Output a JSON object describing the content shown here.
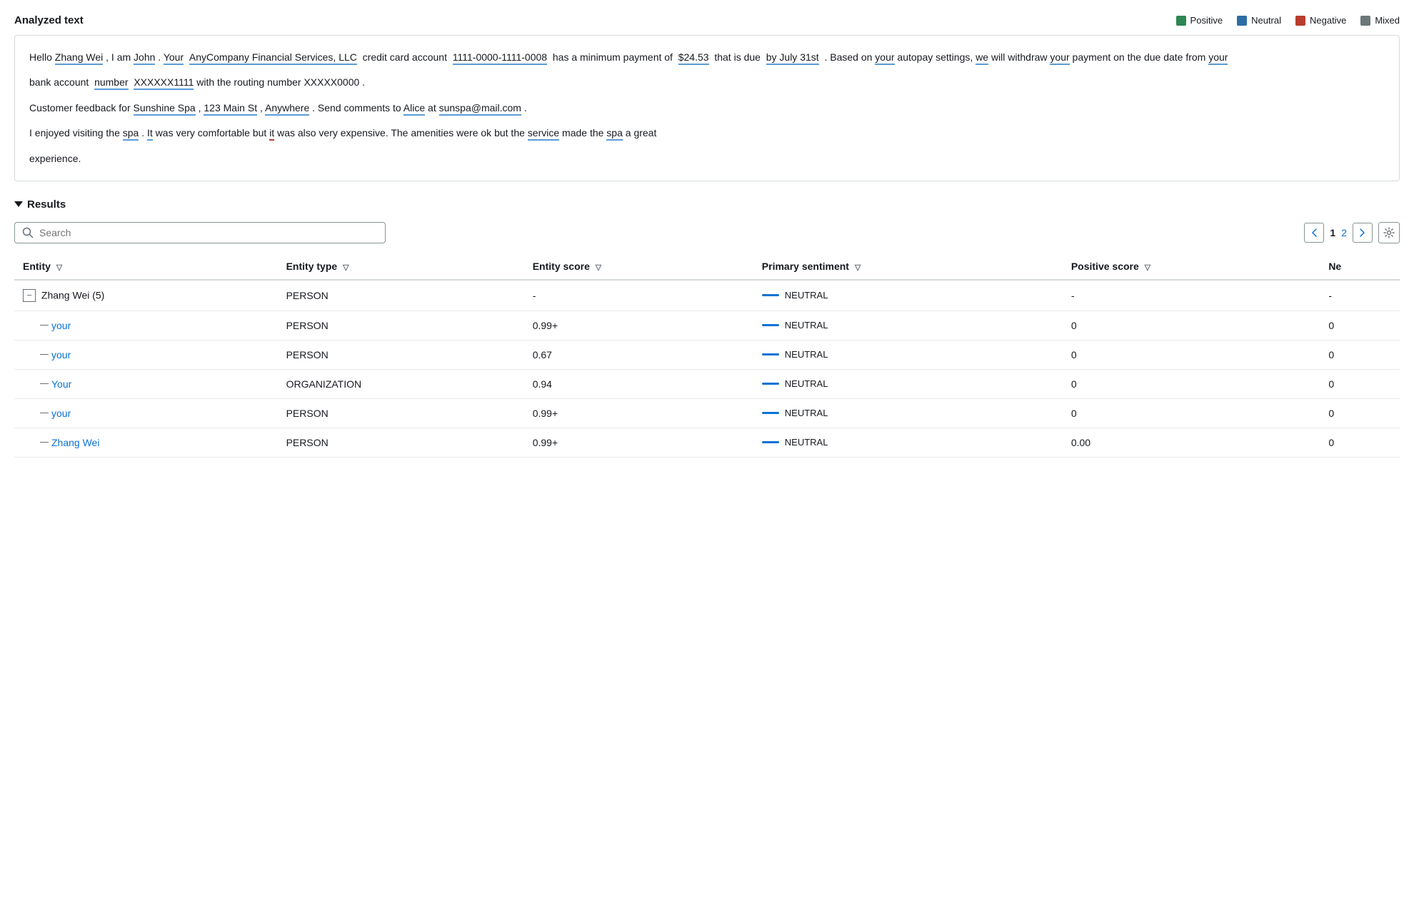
{
  "header": {
    "title": "Analyzed text"
  },
  "legend": [
    {
      "label": "Positive",
      "color": "#2d8653"
    },
    {
      "label": "Neutral",
      "color": "#2e6da4"
    },
    {
      "label": "Negative",
      "color": "#b83c2b"
    },
    {
      "label": "Mixed",
      "color": "#6c7778"
    }
  ],
  "analyzed_text": {
    "lines": [
      "Hello Zhang Wei , I am John . Your AnyCompany Financial Services, LLC credit card account 1111-0000-1111-0008 has a minimum payment of $24.53 that is due by July 31st . Based on your autopay settings, we will withdraw your payment on the due date from your bank account number XXXXXX1111 with the routing number XXXXX0000 .",
      "Customer feedback for Sunshine Spa , 123 Main St , Anywhere . Send comments to Alice at sunspa@mail.com .",
      "I enjoyed visiting the spa . It was very comfortable but it was also very expensive. The amenities were ok but the service made the spa a great experience."
    ]
  },
  "results": {
    "title": "Results",
    "search": {
      "placeholder": "Search"
    },
    "pagination": {
      "current": "1",
      "next": "2",
      "prev_label": "<",
      "next_label": ">"
    },
    "columns": [
      {
        "label": "Entity",
        "key": "entity"
      },
      {
        "label": "Entity type",
        "key": "type"
      },
      {
        "label": "Entity score",
        "key": "score"
      },
      {
        "label": "Primary sentiment",
        "key": "sentiment"
      },
      {
        "label": "Positive score",
        "key": "positive_score"
      },
      {
        "label": "Ne",
        "key": "ne_score"
      }
    ],
    "rows": [
      {
        "id": "zhang-wei-group",
        "entity": "Zhang Wei (5)",
        "type": "PERSON",
        "score": "-",
        "sentiment": "NEUTRAL",
        "positive_score": "-",
        "ne_score": "-",
        "is_parent": true,
        "children": [
          {
            "entity": "your",
            "type": "PERSON",
            "score": "0.99+",
            "sentiment": "NEUTRAL",
            "positive_score": "0",
            "ne_score": "0"
          },
          {
            "entity": "your",
            "type": "PERSON",
            "score": "0.67",
            "sentiment": "NEUTRAL",
            "positive_score": "0",
            "ne_score": "0"
          },
          {
            "entity": "Your",
            "type": "ORGANIZATION",
            "score": "0.94",
            "sentiment": "NEUTRAL",
            "positive_score": "0",
            "ne_score": "0"
          },
          {
            "entity": "your",
            "type": "PERSON",
            "score": "0.99+",
            "sentiment": "NEUTRAL",
            "positive_score": "0",
            "ne_score": "0"
          },
          {
            "entity": "Zhang Wei",
            "type": "PERSON",
            "score": "0.99+",
            "sentiment": "NEUTRAL",
            "positive_score": "0.00",
            "ne_score": "0"
          }
        ]
      }
    ]
  }
}
